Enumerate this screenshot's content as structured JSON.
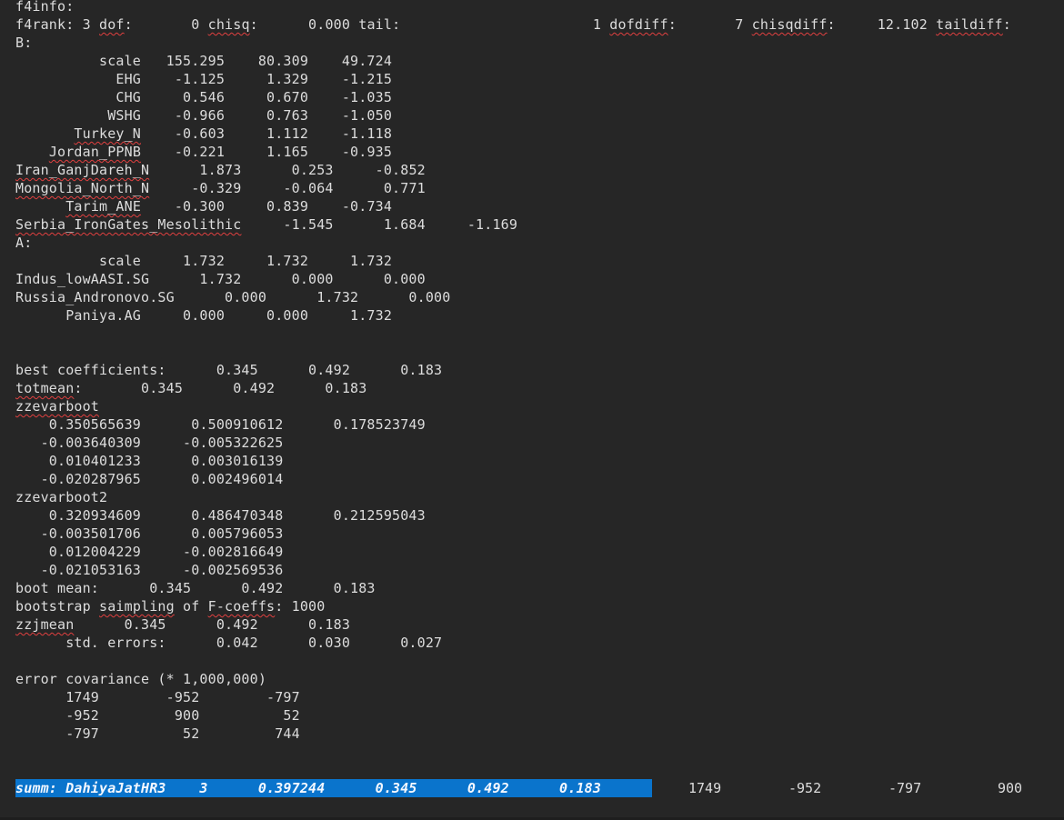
{
  "lines": [
    {
      "t": "f4info:"
    },
    {
      "t": "f4rank: 3 dof:       0 chisq:      0.000 tail:                       1 dofdiff:       7 chisqdiff:     12.102 taildiff:",
      "sq": [
        "dof",
        "chisq",
        "dofdiff",
        "chisqdiff",
        "taildiff"
      ]
    },
    {
      "t": "B:"
    },
    {
      "t": "          scale   155.295    80.309    49.724"
    },
    {
      "t": "            EHG    -1.125     1.329    -1.215"
    },
    {
      "t": "            CHG     0.546     0.670    -1.035"
    },
    {
      "t": "           WSHG    -0.966     0.763    -1.050"
    },
    {
      "t": "       Turkey_N    -0.603     1.112    -1.118",
      "sq": [
        "Turkey_N"
      ]
    },
    {
      "t": "    Jordan_PPNB    -0.221     1.165    -0.935",
      "sq": [
        "Jordan_PPNB"
      ]
    },
    {
      "t": "Iran_GanjDareh_N      1.873      0.253     -0.852",
      "sq": [
        "Iran_GanjDareh_N"
      ]
    },
    {
      "t": "Mongolia_North_N     -0.329     -0.064      0.771",
      "sq": [
        "Mongolia_North_N"
      ]
    },
    {
      "t": "      Tarim_ANE    -0.300     0.839    -0.734",
      "sq": [
        "Tarim_ANE"
      ]
    },
    {
      "t": "Serbia_IronGates_Mesolithic     -1.545      1.684     -1.169",
      "sq": [
        "Serbia_IronGates_Mesolithic"
      ]
    },
    {
      "t": "A:"
    },
    {
      "t": "          scale     1.732     1.732     1.732"
    },
    {
      "t": "Indus_lowAASI.SG      1.732      0.000      0.000"
    },
    {
      "t": "Russia_Andronovo.SG      0.000      1.732      0.000"
    },
    {
      "t": "      Paniya.AG     0.000     0.000     1.732"
    },
    {
      "t": ""
    },
    {
      "t": ""
    },
    {
      "t": "best coefficients:      0.345      0.492      0.183"
    },
    {
      "t": "totmean:       0.345      0.492      0.183",
      "sq": [
        "totmean"
      ]
    },
    {
      "t": "zzevarboot",
      "sq": [
        "zzevarboot"
      ]
    },
    {
      "t": "    0.350565639      0.500910612      0.178523749"
    },
    {
      "t": "   -0.003640309     -0.005322625"
    },
    {
      "t": "    0.010401233      0.003016139"
    },
    {
      "t": "   -0.020287965      0.002496014"
    },
    {
      "t": "zzevarboot2"
    },
    {
      "t": "    0.320934609      0.486470348      0.212595043"
    },
    {
      "t": "   -0.003501706      0.005796053"
    },
    {
      "t": "    0.012004229     -0.002816649"
    },
    {
      "t": "   -0.021053163     -0.002569536"
    },
    {
      "t": "boot mean:      0.345      0.492      0.183"
    },
    {
      "t": "bootstrap saimpling of F-coeffs: 1000",
      "sq": [
        "saimpling",
        "F-coeffs"
      ]
    },
    {
      "t": "zzjmean      0.345      0.492      0.183",
      "sq": [
        "zzjmean"
      ]
    },
    {
      "t": "      std. errors:      0.042      0.030      0.027"
    },
    {
      "t": ""
    },
    {
      "t": "error covariance (* 1,000,000)"
    },
    {
      "t": "      1749        -952        -797"
    },
    {
      "t": "      -952         900          52"
    },
    {
      "t": "      -797          52         744"
    },
    {
      "t": ""
    },
    {
      "t": ""
    }
  ],
  "summary": {
    "highlighted": "summ: DahiyaJatHR3    3      0.397244      0.345      0.492      0.183",
    "rest": [
      {
        "v": "1749"
      },
      {
        "v": "-952"
      },
      {
        "v": "-797"
      },
      {
        "v": "900"
      }
    ]
  },
  "colors": {
    "background": "#262626",
    "text": "#dcdcdc",
    "selection": "#0a74cc",
    "squiggle": "#e04040"
  }
}
